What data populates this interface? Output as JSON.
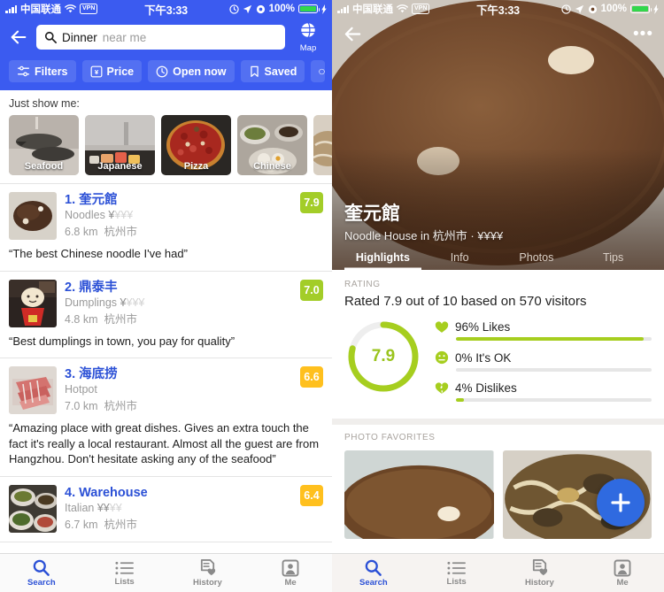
{
  "status_bar": {
    "signal": "signal-bars-icon",
    "carrier": "中国联通",
    "wifi": "wifi-icon",
    "vpn": "VPN",
    "time": "下午3:33",
    "alarm": "alarm-icon",
    "location": "location-arrow-icon",
    "rotation_lock": "rotation-lock-icon",
    "battery_pct": "100%",
    "charging": "charging-bolt-icon"
  },
  "left_panel": {
    "back": "back-arrow-icon",
    "search": {
      "icon": "search-icon",
      "value": "Dinner",
      "placeholder": "near me"
    },
    "map_button": {
      "icon": "globe-icon",
      "label": "Map"
    },
    "chips": [
      {
        "label": "Filters",
        "icon": "sliders-icon"
      },
      {
        "label": "Price",
        "icon": "yen-box-icon"
      },
      {
        "label": "Open now",
        "icon": "clock-icon"
      },
      {
        "label": "Saved",
        "icon": "bookmark-icon"
      },
      {
        "label": "",
        "icon": "clock-icon"
      }
    ],
    "just_show_me": "Just show me:",
    "tiles": [
      {
        "label": "Seafood"
      },
      {
        "label": "Japanese"
      },
      {
        "label": "Pizza"
      },
      {
        "label": "Chinese"
      },
      {
        "label": ""
      }
    ],
    "results": [
      {
        "name": "1. 奎元館",
        "category": "Noodles",
        "price_on": "¥",
        "price_off": "¥¥¥",
        "distance": "6.8 km",
        "city": "杭州市",
        "score": "7.9",
        "score_color": "#a3cd28",
        "quote": "“The best Chinese noodle I've had”"
      },
      {
        "name": "2. 鼎泰丰",
        "category": "Dumplings",
        "price_on": "¥",
        "price_off": "¥¥¥",
        "distance": "4.8 km",
        "city": "杭州市",
        "score": "7.0",
        "score_color": "#a3cd28",
        "quote": "“Best dumplings in town, you pay for quality”"
      },
      {
        "name": "3. 海底捞",
        "category": "Hotpot",
        "price_on": "",
        "price_off": "",
        "distance": "7.0 km",
        "city": "杭州市",
        "score": "6.6",
        "score_color": "#ffc01e",
        "quote": "“Amazing place with great dishes. Gives an extra touch the fact it's really a local restaurant. Almost all the guest are from Hangzhou. Don't hesitate asking any of the seafood”"
      },
      {
        "name": "4. Warehouse",
        "category": "Italian",
        "price_on": "¥¥",
        "price_off": "¥¥",
        "distance": "6.7 km",
        "city": "杭州市",
        "score": "6.4",
        "score_color": "#ffc01e",
        "quote": ""
      }
    ]
  },
  "right_panel": {
    "back": "back-arrow-icon",
    "more": "more-dots-icon",
    "venue": {
      "name": "奎元館",
      "subtitle": "Noodle House in 杭州市 · ¥¥¥¥"
    },
    "tabs": [
      {
        "label": "Highlights",
        "active": true
      },
      {
        "label": "Info",
        "active": false
      },
      {
        "label": "Photos",
        "active": false
      },
      {
        "label": "Tips",
        "active": false
      }
    ],
    "rating": {
      "section_label": "RATING",
      "summary": "Rated 7.9 out of 10 based on 570 visitors",
      "dial_value": "7.9",
      "dial_pct": 79,
      "dial_color": "#a6ce1f",
      "sentiments": [
        {
          "icon": "heart-icon",
          "label": "96% Likes",
          "pct": 96
        },
        {
          "icon": "neutral-face-icon",
          "label": "0% It's OK",
          "pct": 0
        },
        {
          "icon": "broken-heart-icon",
          "label": "4% Dislikes",
          "pct": 4
        }
      ]
    },
    "photo_favorites": {
      "section_label": "PHOTO FAVORITES"
    },
    "add_button": {
      "icon": "plus-icon",
      "color": "#2f6ae0"
    }
  },
  "tabbar": [
    {
      "label": "Search",
      "icon": "search-icon",
      "active": true
    },
    {
      "label": "Lists",
      "icon": "list-icon",
      "active": false
    },
    {
      "label": "History",
      "icon": "history-heart-icon",
      "active": false
    },
    {
      "label": "Me",
      "icon": "person-icon",
      "active": false
    }
  ]
}
